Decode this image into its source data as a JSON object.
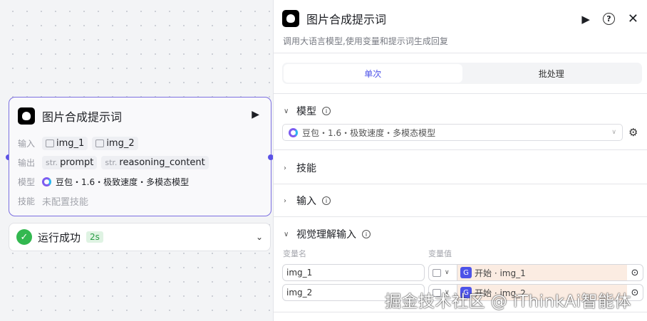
{
  "node": {
    "title": "图片合成提示词",
    "input_label": "输入",
    "inputs": [
      "img_1",
      "img_2"
    ],
    "output_label": "输出",
    "outputs": [
      {
        "type": "str.",
        "name": "prompt"
      },
      {
        "type": "str.",
        "name": "reasoning_content"
      }
    ],
    "model_label": "模型",
    "model": "豆包・1.6・极致速度・多模态模型",
    "skill_label": "技能",
    "skill_value": "未配置技能"
  },
  "run": {
    "status": "运行成功",
    "duration": "2s"
  },
  "panel": {
    "title": "图片合成提示词",
    "description": "调用大语言模型,使用变量和提示词生成回复",
    "tabs": [
      "单次",
      "批处理"
    ],
    "sections": {
      "model": "模型",
      "skills": "技能",
      "input": "输入",
      "vision": "视觉理解输入"
    },
    "model_select": "豆包・1.6・极致速度・多模态模型",
    "var_name_label": "变量名",
    "var_value_label": "变量值",
    "vars": [
      {
        "name": "img_1",
        "source": "开始 · img_1"
      },
      {
        "name": "img_2",
        "source": "开始 · img_2"
      }
    ]
  },
  "watermark": "掘金技术社区 @ iThinkAi智能体"
}
